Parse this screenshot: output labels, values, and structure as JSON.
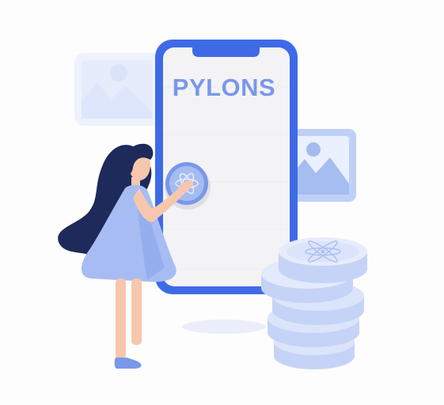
{
  "app": {
    "brand_text": "PYLONS"
  },
  "illustration": {
    "elements": [
      "landscape-photo-icon",
      "smartphone",
      "atom-coin-button-icon",
      "woman-figure",
      "atom-coin-stack"
    ]
  },
  "colors": {
    "phone_frame": "#3f6ae6",
    "phone_screen": "#f3f3f5",
    "brand_text": "#7b97ea",
    "coin_light": "#dbe4fb",
    "coin_mid": "#c5d3f6",
    "dress": "#a7bcf2",
    "hair": "#1d2a5a",
    "skin": "#f6c7ad",
    "photo_light": "#ecf1fd",
    "photo_mid": "#a5bdf1"
  }
}
